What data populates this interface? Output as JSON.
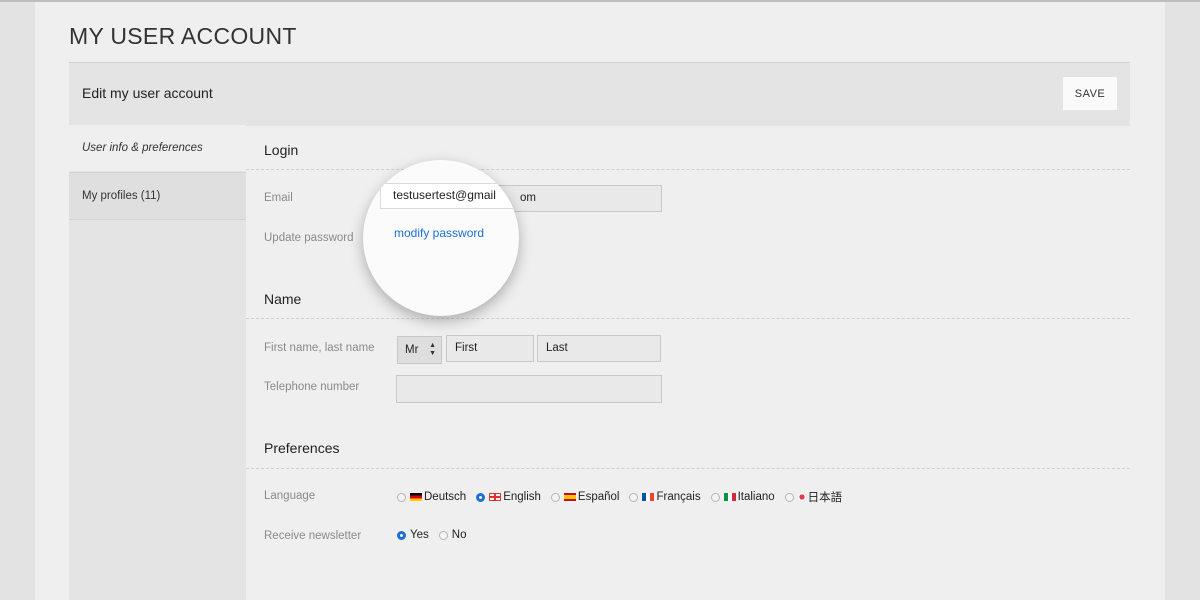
{
  "page": {
    "title": "MY USER ACCOUNT"
  },
  "header": {
    "title": "Edit my user account",
    "save_label": "SAVE"
  },
  "sidebar": {
    "items": [
      {
        "label": "User info & preferences",
        "active": true
      },
      {
        "label": "My profiles (11)",
        "active": false
      }
    ]
  },
  "login": {
    "title": "Login",
    "email_label": "Email",
    "email_value": "testusertest@gmail.com",
    "email_visible_tail": "om",
    "password_label": "Update password",
    "password_link": "modify password"
  },
  "name": {
    "title": "Name",
    "fullname_label": "First name, last name",
    "salutation": "Mr",
    "first_placeholder": "First",
    "last_placeholder": "Last",
    "phone_label": "Telephone number",
    "phone_value": ""
  },
  "preferences": {
    "title": "Preferences",
    "language_label": "Language",
    "languages": [
      {
        "label": "Deutsch",
        "flag": "de",
        "selected": false
      },
      {
        "label": "English",
        "flag": "gb",
        "selected": true
      },
      {
        "label": "Español",
        "flag": "es",
        "selected": false
      },
      {
        "label": "Français",
        "flag": "fr",
        "selected": false
      },
      {
        "label": "Italiano",
        "flag": "it",
        "selected": false
      },
      {
        "label": "日本語",
        "flag": "jp",
        "selected": false
      }
    ],
    "newsletter_label": "Receive newsletter",
    "newsletter_options": [
      {
        "label": "Yes",
        "selected": true
      },
      {
        "label": "No",
        "selected": false
      }
    ]
  },
  "magnifier": {
    "email_text": "testusertest@gmail",
    "link_text": "modify password"
  },
  "colors": {
    "accent": "#1a6fd8",
    "background": "#efefef",
    "panel": "#e4e4e4"
  }
}
